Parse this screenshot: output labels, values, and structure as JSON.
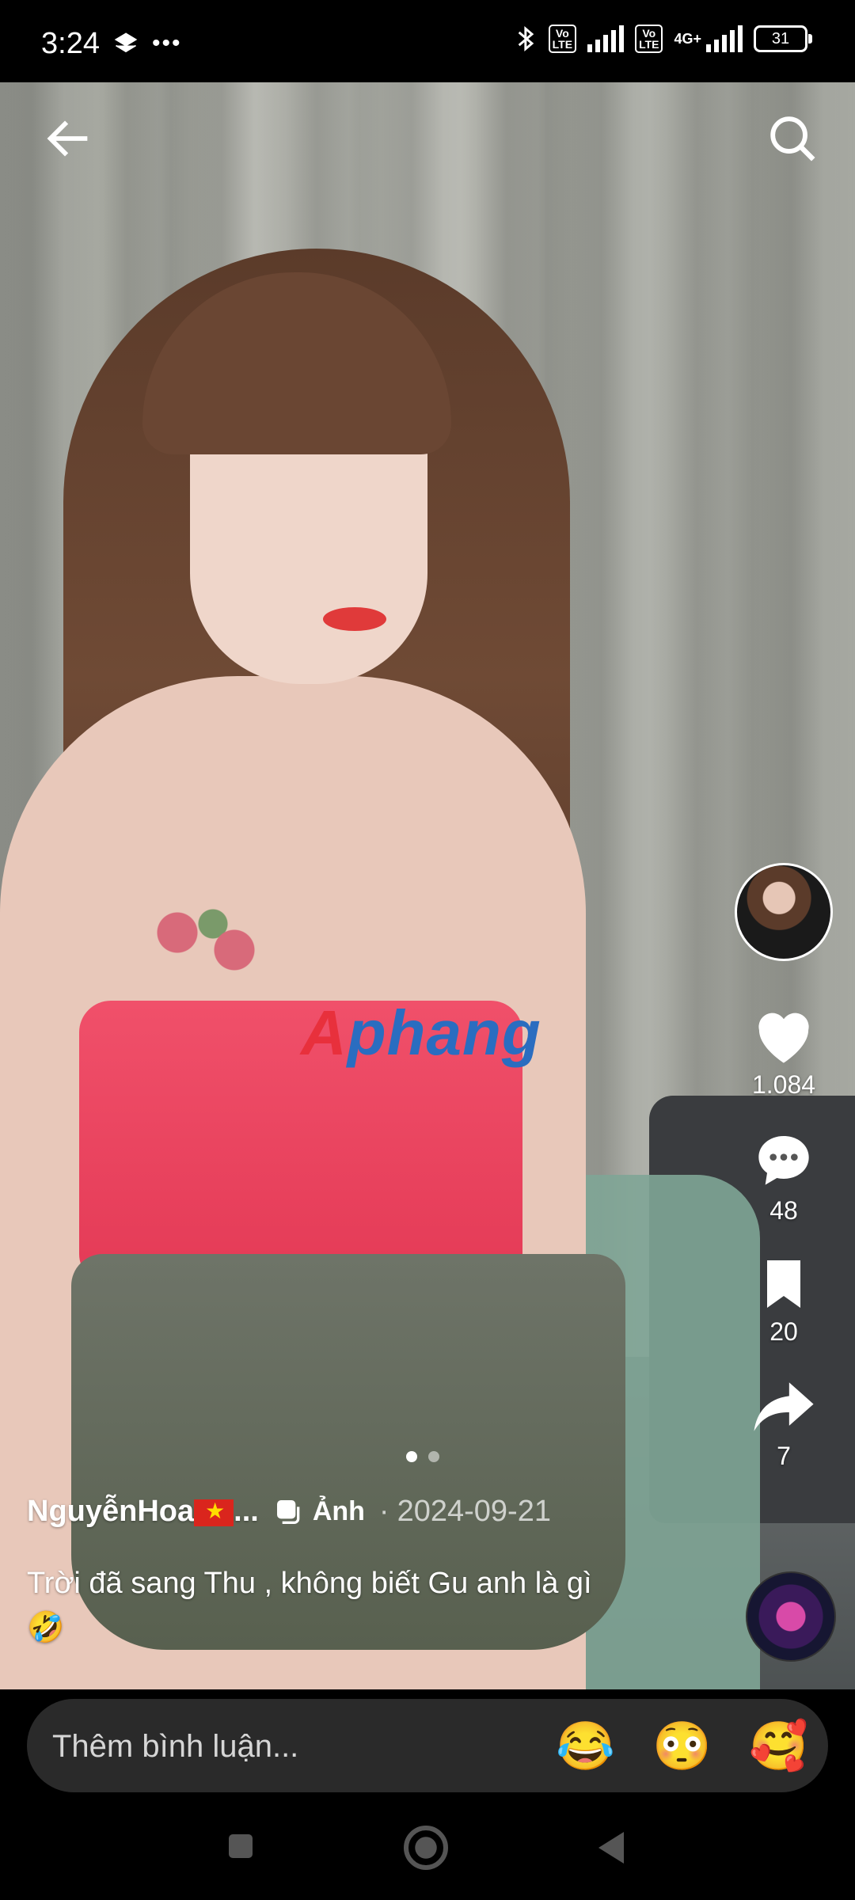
{
  "status_bar": {
    "time": "3:24",
    "battery": "31",
    "network": "4G+"
  },
  "watermark": {
    "first": "A",
    "rest": "phang"
  },
  "post": {
    "author": "NguyễnHoa",
    "author_suffix": "...",
    "type_label": "Ảnh",
    "separator": "·",
    "date": "2024-09-21",
    "caption": "Trời đã sang Thu , không biết Gu anh là gì 🤣",
    "page_indicator": {
      "current": 1,
      "total": 2
    }
  },
  "actions": {
    "likes": "1.084",
    "comments": "48",
    "saves": "20",
    "shares": "7"
  },
  "comment_bar": {
    "placeholder": "Thêm bình luận...",
    "emojis": [
      "😂",
      "😳",
      "🥰"
    ]
  },
  "colors": {
    "accent_red": "#e8303c",
    "watermark_blue": "#2a6dc0"
  },
  "icons": [
    "back-arrow-icon",
    "search-icon",
    "heart-icon",
    "comment-icon",
    "bookmark-icon",
    "share-icon",
    "photo-icon"
  ]
}
